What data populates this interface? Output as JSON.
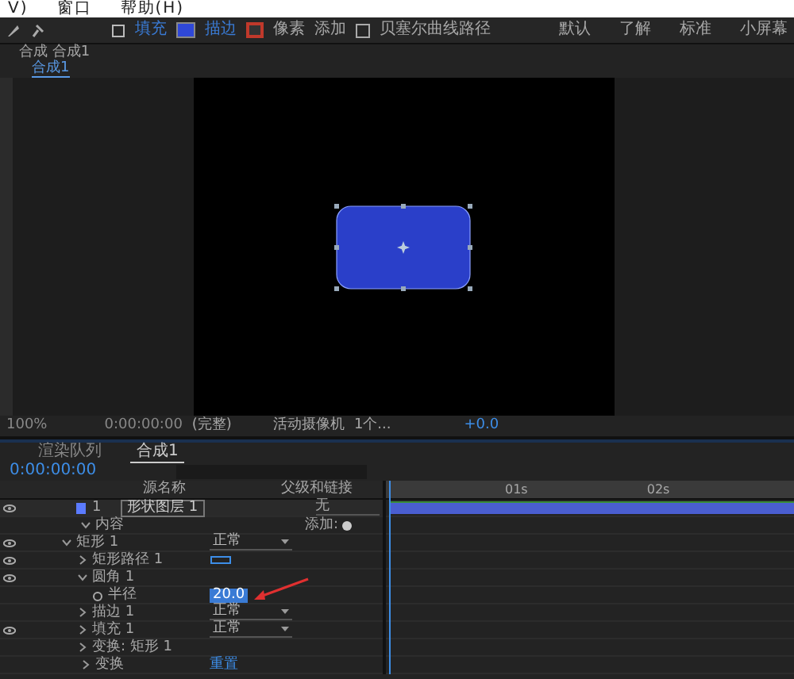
{
  "menu": [
    "V)",
    "窗口",
    "帮助(H)"
  ],
  "toolbar": {
    "fill_label": "填充",
    "stroke_label": "描边",
    "pixels": "像素",
    "add": "添加",
    "bezier": {
      "label": "贝塞尔曲线路径",
      "checked": false
    },
    "workspaces": [
      "默认",
      "了解",
      "标准",
      "小屏幕"
    ]
  },
  "comp_panel": {
    "tab": "合成 合成1",
    "breadcrumb": "合成1"
  },
  "viewer_controls": {
    "zoom": "100%",
    "timecode": "0:00:00:00",
    "resolution": "(完整)",
    "camera": "活动摄像机",
    "views": "1个...",
    "exposure": "+0.0"
  },
  "timeline": {
    "tabs": [
      {
        "label": "渲染队列",
        "selected": false
      },
      {
        "label": "合成1",
        "selected": true
      }
    ],
    "timecode": "0:00:00:00",
    "columns": {
      "source": "源名称",
      "parent": "父级和链接"
    },
    "ruler": [
      "01s",
      "02s"
    ],
    "layer": {
      "number": "1",
      "name": "形状图层 1",
      "parent": "无",
      "color": "#5b7bff"
    },
    "rows": [
      {
        "kind": "add",
        "label": "内容",
        "control": "添加:",
        "expanded": true,
        "visible": false,
        "children": [
          {
            "kind": "mode",
            "label": "矩形 1",
            "control": "正常",
            "expanded": true,
            "visible": true,
            "children": [
              {
                "kind": "path",
                "label": "矩形路径 1",
                "expanded": false,
                "visible": true
              },
              {
                "kind": "group",
                "label": "圆角 1",
                "expanded": true,
                "visible": true,
                "children": [
                  {
                    "kind": "value",
                    "label": "半径",
                    "control": "20.0",
                    "selected": true,
                    "visible": false
                  }
                ]
              },
              {
                "kind": "mode",
                "label": "描边 1",
                "control": "正常",
                "expanded": false,
                "visible": false
              },
              {
                "kind": "mode",
                "label": "填充 1",
                "control": "正常",
                "expanded": false,
                "visible": true
              },
              {
                "kind": "group",
                "label": "变换: 矩形 1",
                "expanded": false,
                "visible": false
              }
            ]
          }
        ]
      },
      {
        "kind": "reset",
        "label": "变换",
        "control": "重置",
        "expanded": false,
        "visible": false
      }
    ]
  }
}
